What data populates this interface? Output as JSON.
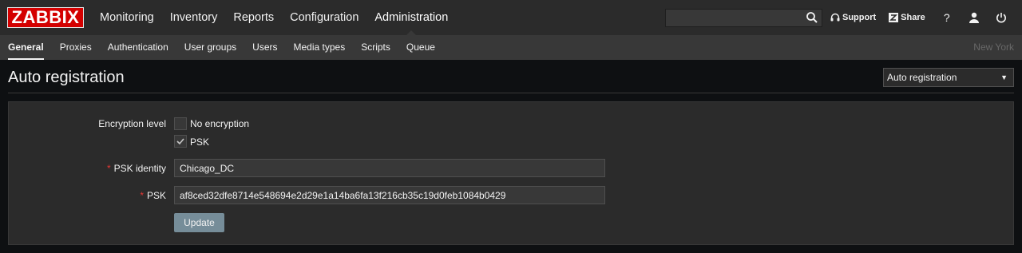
{
  "logo": "ZABBIX",
  "main_menu": [
    {
      "label": "Monitoring"
    },
    {
      "label": "Inventory"
    },
    {
      "label": "Reports"
    },
    {
      "label": "Configuration"
    },
    {
      "label": "Administration",
      "active": true
    }
  ],
  "search": {
    "value": "",
    "placeholder": ""
  },
  "top_links": {
    "support": "Support",
    "share": "Share",
    "help": "?"
  },
  "sub_menu": [
    {
      "label": "General",
      "active": true
    },
    {
      "label": "Proxies"
    },
    {
      "label": "Authentication"
    },
    {
      "label": "User groups"
    },
    {
      "label": "Users"
    },
    {
      "label": "Media types"
    },
    {
      "label": "Scripts"
    },
    {
      "label": "Queue"
    }
  ],
  "server_name": "New York",
  "page": {
    "title": "Auto registration",
    "page_select": {
      "selected": "Auto registration"
    }
  },
  "form": {
    "encryption_level_label": "Encryption level",
    "no_encryption_label": "No encryption",
    "no_encryption_checked": false,
    "psk_option_label": "PSK",
    "psk_option_checked": true,
    "required_mark": "*",
    "psk_identity_label": "PSK identity",
    "psk_identity_value": "Chicago_DC",
    "psk_label": "PSK",
    "psk_value": "af8ced32dfe8714e548694e2d29e1a14ba6fa13f216cb35c19d0feb1084b0429",
    "update_button": "Update"
  },
  "colors": {
    "logo_red": "#d40000",
    "topbar": "#2b2b2b",
    "subbar": "#383838",
    "button": "#768d99",
    "required": "#e33734"
  }
}
